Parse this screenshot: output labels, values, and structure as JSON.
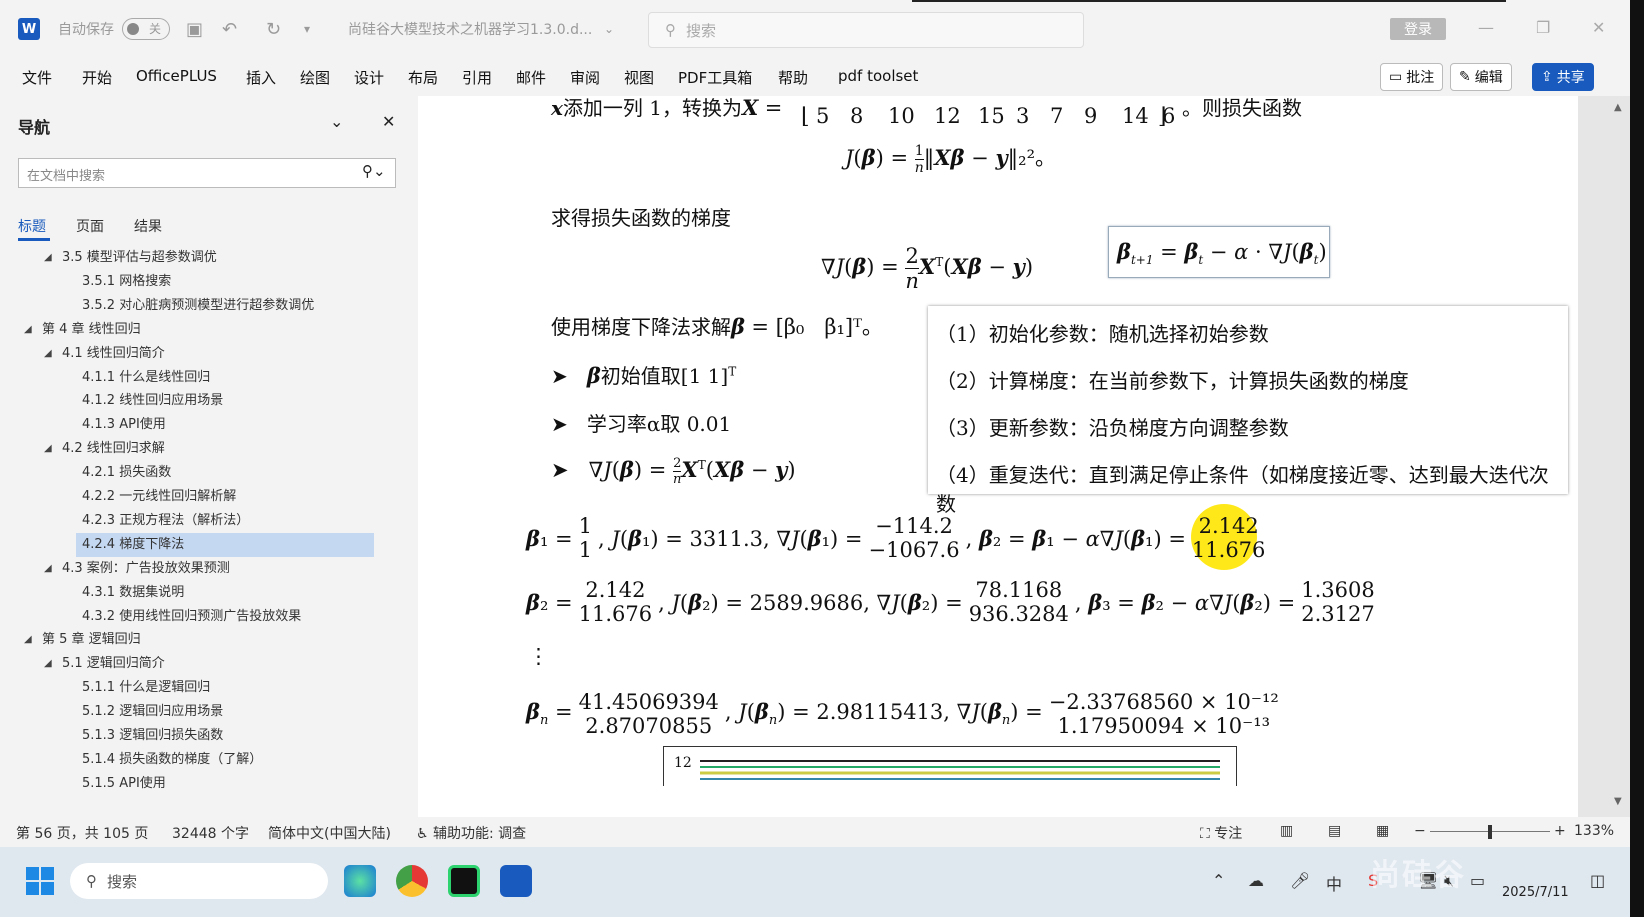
{
  "titlebar": {
    "autosave": "自动保存",
    "autosave_state": "关",
    "doc_title": "尚硅谷大模型技术之机器学习1.3.0.d...",
    "search_placeholder": "搜索",
    "login": "登录"
  },
  "menu": {
    "items": [
      "文件",
      "开始",
      "OfficePLUS",
      "插入",
      "绘图",
      "设计",
      "布局",
      "引用",
      "邮件",
      "审阅",
      "视图",
      "PDF工具箱",
      "帮助",
      "pdf toolset"
    ],
    "comment": "批注",
    "edit": "编辑",
    "share": "共享"
  },
  "nav": {
    "title": "导航",
    "search_placeholder": "在文档中搜索",
    "tabs": [
      "标题",
      "页面",
      "结果"
    ],
    "items": [
      {
        "label": "3.5 模型评估与超参数调优",
        "level": 1,
        "arrow": "◢"
      },
      {
        "label": "3.5.1 网格搜索",
        "level": 2
      },
      {
        "label": "3.5.2 对心脏病预测模型进行超参数调优",
        "level": 2
      },
      {
        "label": "第 4 章 线性回归",
        "level": 0,
        "arrow": "◢"
      },
      {
        "label": "4.1 线性回归简介",
        "level": 1,
        "arrow": "◢"
      },
      {
        "label": "4.1.1 什么是线性回归",
        "level": 2
      },
      {
        "label": "4.1.2 线性回归应用场景",
        "level": 2
      },
      {
        "label": "4.1.3 API使用",
        "level": 2
      },
      {
        "label": "4.2 线性回归求解",
        "level": 1,
        "arrow": "◢"
      },
      {
        "label": "4.2.1 损失函数",
        "level": 2
      },
      {
        "label": "4.2.2 一元线性回归解析解",
        "level": 2
      },
      {
        "label": "4.2.3 正规方程法（解析法）",
        "level": 2
      },
      {
        "label": "4.2.4 梯度下降法",
        "level": 2,
        "selected": true
      },
      {
        "label": "4.3 案例：广告投放效果预测",
        "level": 1,
        "arrow": "◢"
      },
      {
        "label": "4.3.1 数据集说明",
        "level": 2
      },
      {
        "label": "4.3.2 使用线性回归预测广告投放效果",
        "level": 2
      },
      {
        "label": "第 5 章 逻辑回归",
        "level": 0,
        "arrow": "◢"
      },
      {
        "label": "5.1 逻辑回归简介",
        "level": 1,
        "arrow": "◢"
      },
      {
        "label": "5.1.1 什么是逻辑回归",
        "level": 2
      },
      {
        "label": "5.1.2 逻辑回归应用场景",
        "level": 2
      },
      {
        "label": "5.1.3 逻辑回归损失函数",
        "level": 2
      },
      {
        "label": "5.1.4 损失函数的梯度（了解）",
        "level": 2
      },
      {
        "label": "5.1.5 API使用",
        "level": 2
      }
    ]
  },
  "doc": {
    "line1_pre": "添加一列 1，转换为",
    "matrix_row": [
      "5",
      "8",
      "10",
      "12",
      "15",
      "3",
      "7",
      "9",
      "14",
      "6"
    ],
    "line1_post": "。则损失函数",
    "loss_label": "求得损失函数的梯度",
    "gd_line": "使用梯度下降法求解",
    "bullet1": "初始值取[1    1]",
    "bullet2": "学习率α取 0.01",
    "steps": [
      "（1）初始化参数：随机选择初始参数",
      "（2）计算梯度：在当前参数下，计算损失函数的梯度",
      "（3）更新参数：沿负梯度方向调整参数",
      "（4）重复迭代：直到满足停止条件（如梯度接近零、达到最大迭代次数"
    ],
    "iter1": {
      "beta": [
        "1",
        "1"
      ],
      "J": "3311.3",
      "grad": [
        "−114.2",
        "−1067.6"
      ],
      "next": [
        "2.142",
        "11.676"
      ]
    },
    "iter2": {
      "beta": [
        "2.142",
        "11.676"
      ],
      "J": "2589.9686",
      "grad": [
        "78.1168",
        "936.3284"
      ],
      "next": [
        "1.3608",
        "2.3127"
      ]
    },
    "itern": {
      "beta": [
        "41.45069394",
        "2.87070855"
      ],
      "J": "2.98115413",
      "grad": [
        "−2.33768560 × 10⁻¹²",
        "1.17950094 × 10⁻¹³"
      ]
    },
    "chart_tick": "12"
  },
  "status": {
    "page": "第 56 页，共 105 页",
    "words": "32448 个字",
    "lang": "简体中文(中国大陆)",
    "a11y": "辅助功能: 调查",
    "focus": "专注",
    "zoom": "133%"
  },
  "taskbar": {
    "search": "搜索",
    "date": "2025/7/11",
    "watermark": "尚硅谷"
  }
}
